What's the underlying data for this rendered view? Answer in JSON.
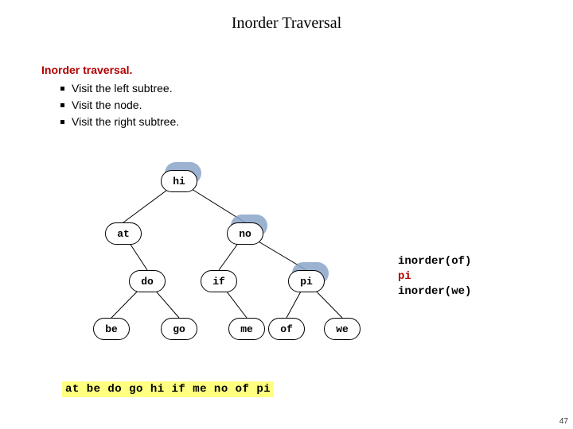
{
  "title": "Inorder Traversal",
  "desc": {
    "head": "Inorder traversal.",
    "b1": "Visit the left subtree.",
    "b2": "Visit the node.",
    "b3": "Visit the right subtree."
  },
  "nodes": {
    "hi": "hi",
    "at": "at",
    "no": "no",
    "do": "do",
    "if": "if",
    "pi": "pi",
    "be": "be",
    "go": "go",
    "me": "me",
    "of": "of",
    "we": "we"
  },
  "code": {
    "l1": "inorder(of)",
    "l2": "pi",
    "l3": "inorder(we)"
  },
  "sequence": "at be do go hi if me no of pi",
  "page": "47",
  "chart_data": {
    "type": "tree",
    "title": "Inorder Traversal",
    "root": "hi",
    "edges": [
      [
        "hi",
        "at"
      ],
      [
        "hi",
        "no"
      ],
      [
        "at",
        "do"
      ],
      [
        "no",
        "if"
      ],
      [
        "no",
        "pi"
      ],
      [
        "do",
        "be"
      ],
      [
        "do",
        "go"
      ],
      [
        "if",
        "me"
      ],
      [
        "pi",
        "of"
      ],
      [
        "pi",
        "we"
      ]
    ],
    "highlighted_path": [
      "hi",
      "no",
      "pi"
    ],
    "visited_output": [
      "at",
      "be",
      "do",
      "go",
      "hi",
      "if",
      "me",
      "no",
      "of",
      "pi"
    ],
    "call_stack_display": [
      "inorder(of)",
      "pi",
      "inorder(we)"
    ]
  }
}
